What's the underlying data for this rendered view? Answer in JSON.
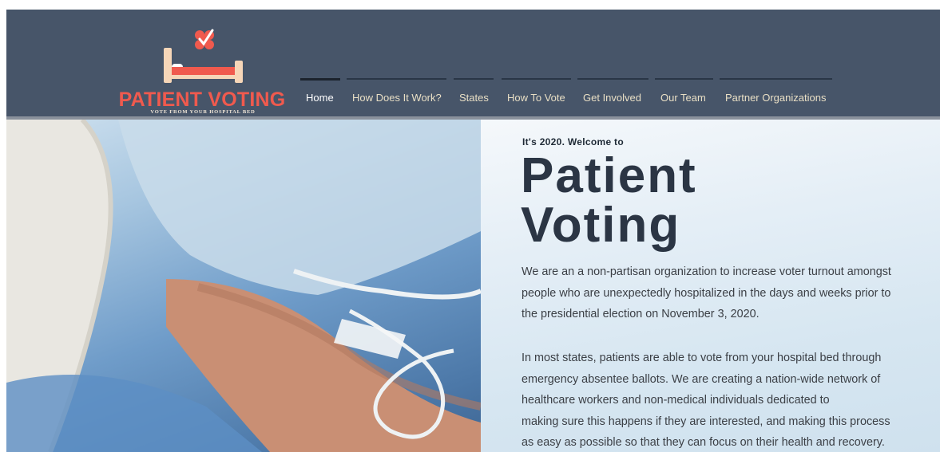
{
  "header": {
    "logo_title": "PATIENT VOTING",
    "logo_tagline": "VOTE FROM YOUR HOSPITAL BED",
    "logo_icon": "hospital-bed-checkmark-icon",
    "colors": {
      "background": "#475569",
      "logo_red": "#f05a4e",
      "nav_text": "#e9dfc5",
      "active": "#1c232d"
    }
  },
  "nav": {
    "items": [
      {
        "label": "Home",
        "active": true
      },
      {
        "label": "How Does It Work?",
        "active": false
      },
      {
        "label": "States",
        "active": false
      },
      {
        "label": "How To Vote",
        "active": false
      },
      {
        "label": "Get Involved",
        "active": false
      },
      {
        "label": "Our Team",
        "active": false
      },
      {
        "label": "Partner Organizations",
        "active": false
      }
    ]
  },
  "hero": {
    "kicker": "It's 2020. Welcome to",
    "title_line1": "Patient",
    "title_line2": "Voting",
    "paragraph1_lines": [
      "We are an a non-partisan organization to increase voter turnout amongst",
      "people who are unexpectedly hospitalized in the days and weeks prior to",
      "the presidential election on November 3, 2020."
    ],
    "paragraph2_lines": [
      "In most states, patients are able to vote from your hospital bed through",
      "emergency absentee ballots. We are creating a nation-wide network of",
      "healthcare workers and non-medical individuals dedicated to",
      "making sure this happens if they are interested, and making this process",
      "as easy as possible so that they can focus on their health and recovery."
    ],
    "image": "hospital-patient-arm-iv-photo"
  }
}
